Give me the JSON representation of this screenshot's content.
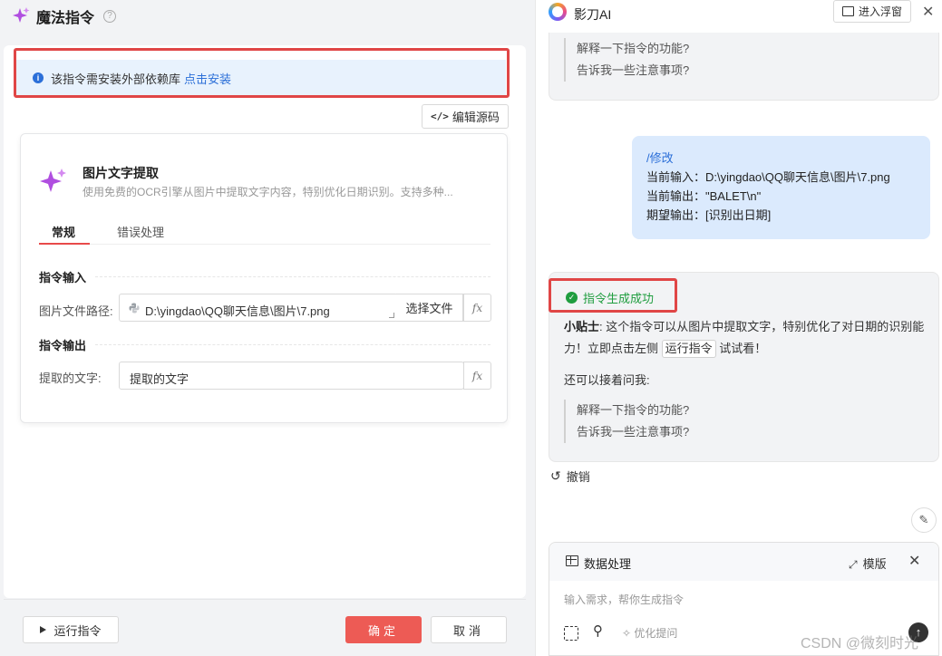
{
  "left": {
    "title": "魔法指令",
    "notice": {
      "text": "该指令需安装外部依赖库",
      "link": "点击安装"
    },
    "edit_source": "编辑源码",
    "command": {
      "name": "图片文字提取",
      "description": "使用免费的OCR引擎从图片中提取文字内容，特别优化日期识别。支持多种..."
    },
    "tabs": [
      "常规",
      "错误处理"
    ],
    "section_input": "指令输入",
    "section_output": "指令输出",
    "image_path": {
      "label": "图片文件路径:",
      "value": "D:\\yingdao\\QQ聊天信息\\图片\\7.png",
      "choose": "选择文件"
    },
    "extracted_text": {
      "label": "提取的文字:",
      "value": "提取的文字"
    },
    "fx": "fx",
    "run": "运行指令",
    "ok": "确定",
    "cancel": "取消"
  },
  "right": {
    "title": "影刀AI",
    "float_btn": "进入浮窗",
    "prev_quotes": [
      "解释一下指令的功能?",
      "告诉我一些注意事项?"
    ],
    "user_msg": {
      "cmd": "/修改",
      "lines": [
        "当前输入：D:\\yingdao\\QQ聊天信息\\图片\\7.png",
        "当前输出：\"BALET\\n\"",
        "期望输出：[识别出日期]"
      ]
    },
    "answer": {
      "status": "指令生成成功",
      "tip_label": "小贴士",
      "tip_text_1": ": 这个指令可以从图片中提取文字，特别优化了对日期的识别能力！立即点击左侧",
      "tip_tag": "运行指令",
      "tip_text_2": "试试看！",
      "ask": "还可以接着问我:",
      "quotes": [
        "解释一下指令的功能?",
        "告诉我一些注意事项?"
      ]
    },
    "undo": "撤销",
    "panel": {
      "title": "数据处理",
      "template": "模版",
      "placeholder": "输入需求，帮你生成指令",
      "optimize": "优化提问"
    }
  },
  "watermark": "CSDN @微刻时光",
  "colors": {
    "accent_red": "#ed5b55",
    "link_blue": "#2b6fd8",
    "success_green": "#1f9d3f",
    "user_bubble": "#dbeafd"
  }
}
